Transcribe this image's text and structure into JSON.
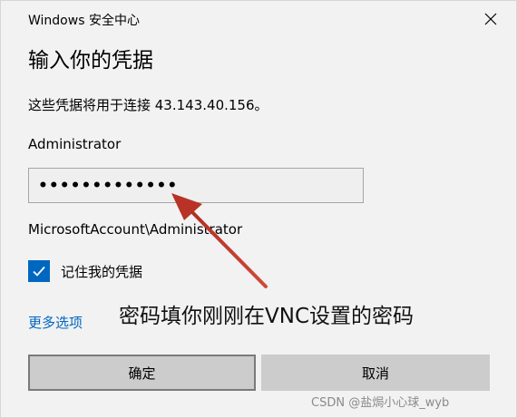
{
  "window": {
    "app_title": "Windows 安全中心",
    "close_icon": "close-icon"
  },
  "dialog": {
    "heading": "输入你的凭据",
    "description": "这些凭据将用于连接 43.143.40.156。",
    "username": "Administrator",
    "password_masked": "•••••••••••••",
    "domain_user": "MicrosoftAccount\\Administrator",
    "remember_label": "记住我的凭据",
    "remember_checked": true,
    "more_options": "更多选项",
    "ok_label": "确定",
    "cancel_label": "取消"
  },
  "annotation": {
    "text": "密码填你刚刚在VNC设置的密码",
    "arrow_color": "#c0392b"
  },
  "watermark": "CSDN @盐焗小心球_wyb",
  "colors": {
    "accent": "#0067c0",
    "background": "#f2f2f2",
    "button": "#cccccc"
  }
}
